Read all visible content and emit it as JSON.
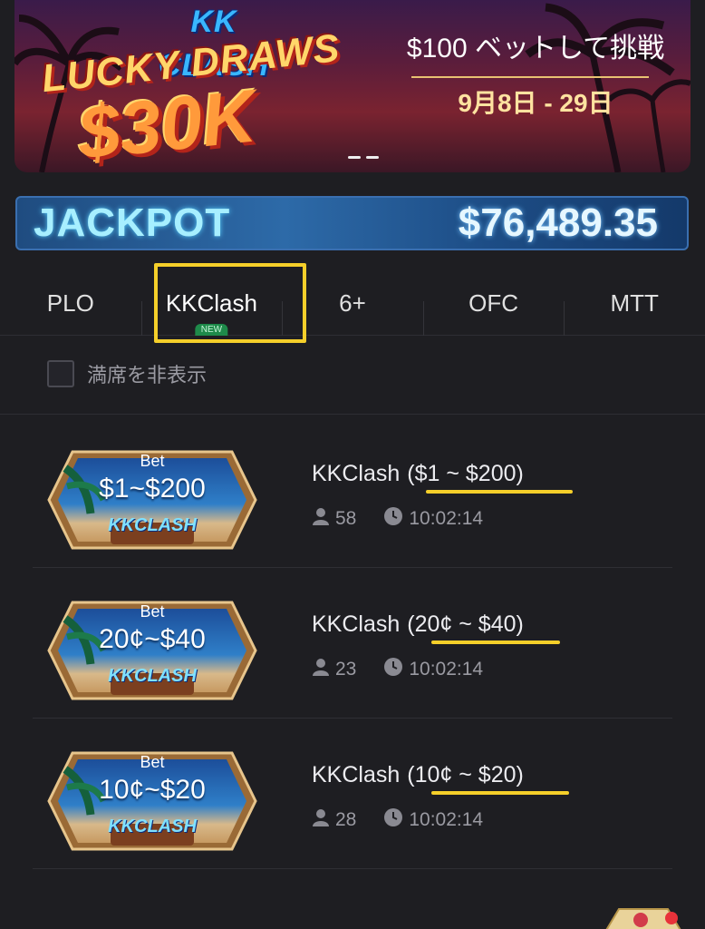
{
  "banner": {
    "logo_text": "KK CLASH",
    "title": "LUCKY DRAWS",
    "prize": "$30K",
    "headline": "$100 ベットして挑戦",
    "dates": "9月8日 - 29日"
  },
  "jackpot": {
    "label": "JACKPOT",
    "amount": "$76,489.35"
  },
  "tabs": [
    {
      "label": "PLO",
      "active": false
    },
    {
      "label": "KKClash",
      "active": true,
      "badge": "NEW"
    },
    {
      "label": "6+",
      "active": false
    },
    {
      "label": "OFC",
      "active": false
    },
    {
      "label": "MTT",
      "active": false
    }
  ],
  "filter": {
    "hide_full_label": "満席を非表示",
    "checked": false
  },
  "rooms": [
    {
      "bet_label": "Bet",
      "range": "$1~$200",
      "brand": "KKCLASH",
      "name": "KKClash",
      "stakes": "($1 ~ $200)",
      "players": "58",
      "time": "10:02:14"
    },
    {
      "bet_label": "Bet",
      "range": "20¢~$40",
      "brand": "KKCLASH",
      "name": "KKClash",
      "stakes": "(20¢ ~ $40)",
      "players": "23",
      "time": "10:02:14"
    },
    {
      "bet_label": "Bet",
      "range": "10¢~$20",
      "brand": "KKCLASH",
      "name": "KKClash",
      "stakes": "(10¢ ~ $20)",
      "players": "28",
      "time": "10:02:14"
    }
  ],
  "colors": {
    "background": "#1e1e22",
    "highlight": "#f5cf2a",
    "jackpot_text": "#a7efff"
  },
  "icons": [
    "person-icon",
    "clock-icon",
    "palm-tree-icon"
  ]
}
